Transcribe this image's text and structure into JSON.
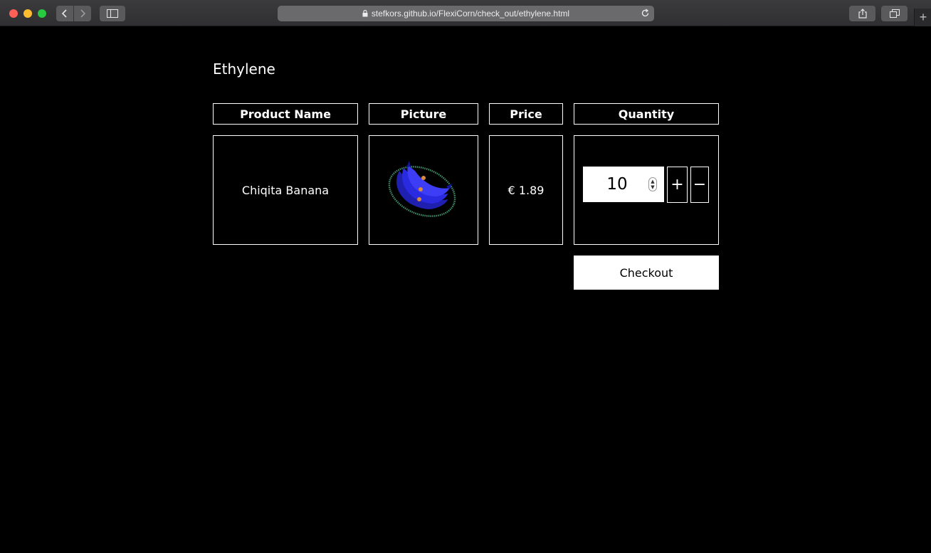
{
  "browser": {
    "url": "stefkors.github.io/FlexiCorn/check_out/ethylene.html",
    "new_tab_symbol": "+"
  },
  "page": {
    "title": "Ethylene"
  },
  "table": {
    "headers": [
      "Product Name",
      "Picture",
      "Price",
      "Quantity"
    ],
    "rows": [
      {
        "product_name": "Chiqita Banana",
        "picture": "blue-banana-image",
        "price": "€ 1.89",
        "quantity": "10"
      }
    ]
  },
  "quantity_controls": {
    "increment_label": "+",
    "decrement_label": "−"
  },
  "checkout": {
    "label": "Checkout"
  },
  "colors": {
    "background": "#000000",
    "foreground": "#ffffff",
    "banana": "#2a2ae0",
    "ring": "#3f8f6a"
  }
}
